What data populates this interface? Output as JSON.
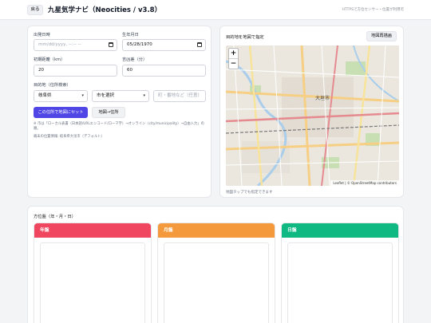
{
  "header": {
    "back_label": "戻る",
    "title": "九星気学ナビ（Neocities / v3.8）",
    "https_note": "HTTPSで方位センサー・位置が利用可"
  },
  "form": {
    "travel_date_label": "出発日時",
    "travel_date_placeholder": "mm/dd/yyyy, --:-- --",
    "birth_date_label": "生年月日",
    "birth_date_value": "05/28/1970",
    "initial_distance_label": "初期距離（km）",
    "initial_distance_value": "20",
    "tolerance_label": "吉凶差（分）",
    "tolerance_value": "60",
    "destination_label": "目的地（住所検索）",
    "prefecture_value": "岐阜県",
    "city_value": "市を選択",
    "town_placeholder": "町・番地など（任意）",
    "set_on_map_label": "この住所で地図にセット",
    "map_to_address_label": "地図→住所",
    "note": "※ 市は「ローカル表書（日本語/URLエンコード/ローマ字）→オンライン（city/municipality）→自由入力」の順。",
    "current_location_note": "端末の位置情報: 岐阜県大垣市（デフォルト）"
  },
  "map_card": {
    "title": "目的地を地図で指定",
    "recenter_label": "地図再描画",
    "zoom_in": "+",
    "zoom_out": "−",
    "attribution": "Leaflet | © OpenStreetMap contributors",
    "city_label": "大垣市",
    "caption": "地図タップでも指定できます"
  },
  "directions": {
    "title": "方位盤（年・月・日）",
    "panels": [
      {
        "label": "年盤",
        "color": "#f0465f"
      },
      {
        "label": "月盤",
        "color": "#f59a3c"
      },
      {
        "label": "日盤",
        "color": "#10b981"
      }
    ]
  }
}
